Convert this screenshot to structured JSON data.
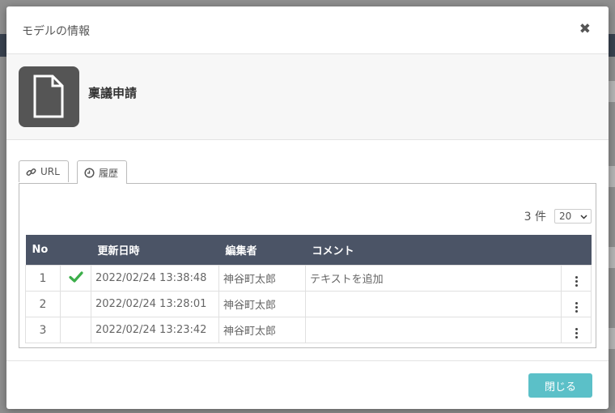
{
  "modal": {
    "title": "モデルの情報",
    "close_icon": "close-icon"
  },
  "model": {
    "name": "稟議申請",
    "icon": "document-icon"
  },
  "tabs": [
    {
      "label": "URL",
      "icon": "link-icon"
    },
    {
      "label": "履歴",
      "icon": "clock-icon",
      "active": true
    }
  ],
  "history": {
    "count": "3",
    "count_unit": "件",
    "page_size": "20",
    "columns": {
      "no": "No",
      "check": "",
      "updated": "更新日時",
      "editor": "編集者",
      "comment": "コメント"
    },
    "rows": [
      {
        "no": "1",
        "current": true,
        "updated": "2022/02/24 13:38:48",
        "editor": "神谷町太郎",
        "comment": "テキストを追加"
      },
      {
        "no": "2",
        "current": false,
        "updated": "2022/02/24 13:28:01",
        "editor": "神谷町太郎",
        "comment": ""
      },
      {
        "no": "3",
        "current": false,
        "updated": "2022/02/24 13:23:42",
        "editor": "神谷町太郎",
        "comment": ""
      }
    ]
  },
  "footer": {
    "close_label": "閉じる"
  },
  "colors": {
    "header_bg": "#4b5466",
    "primary_button": "#5bc0c8",
    "check_green": "#3cae4a"
  }
}
